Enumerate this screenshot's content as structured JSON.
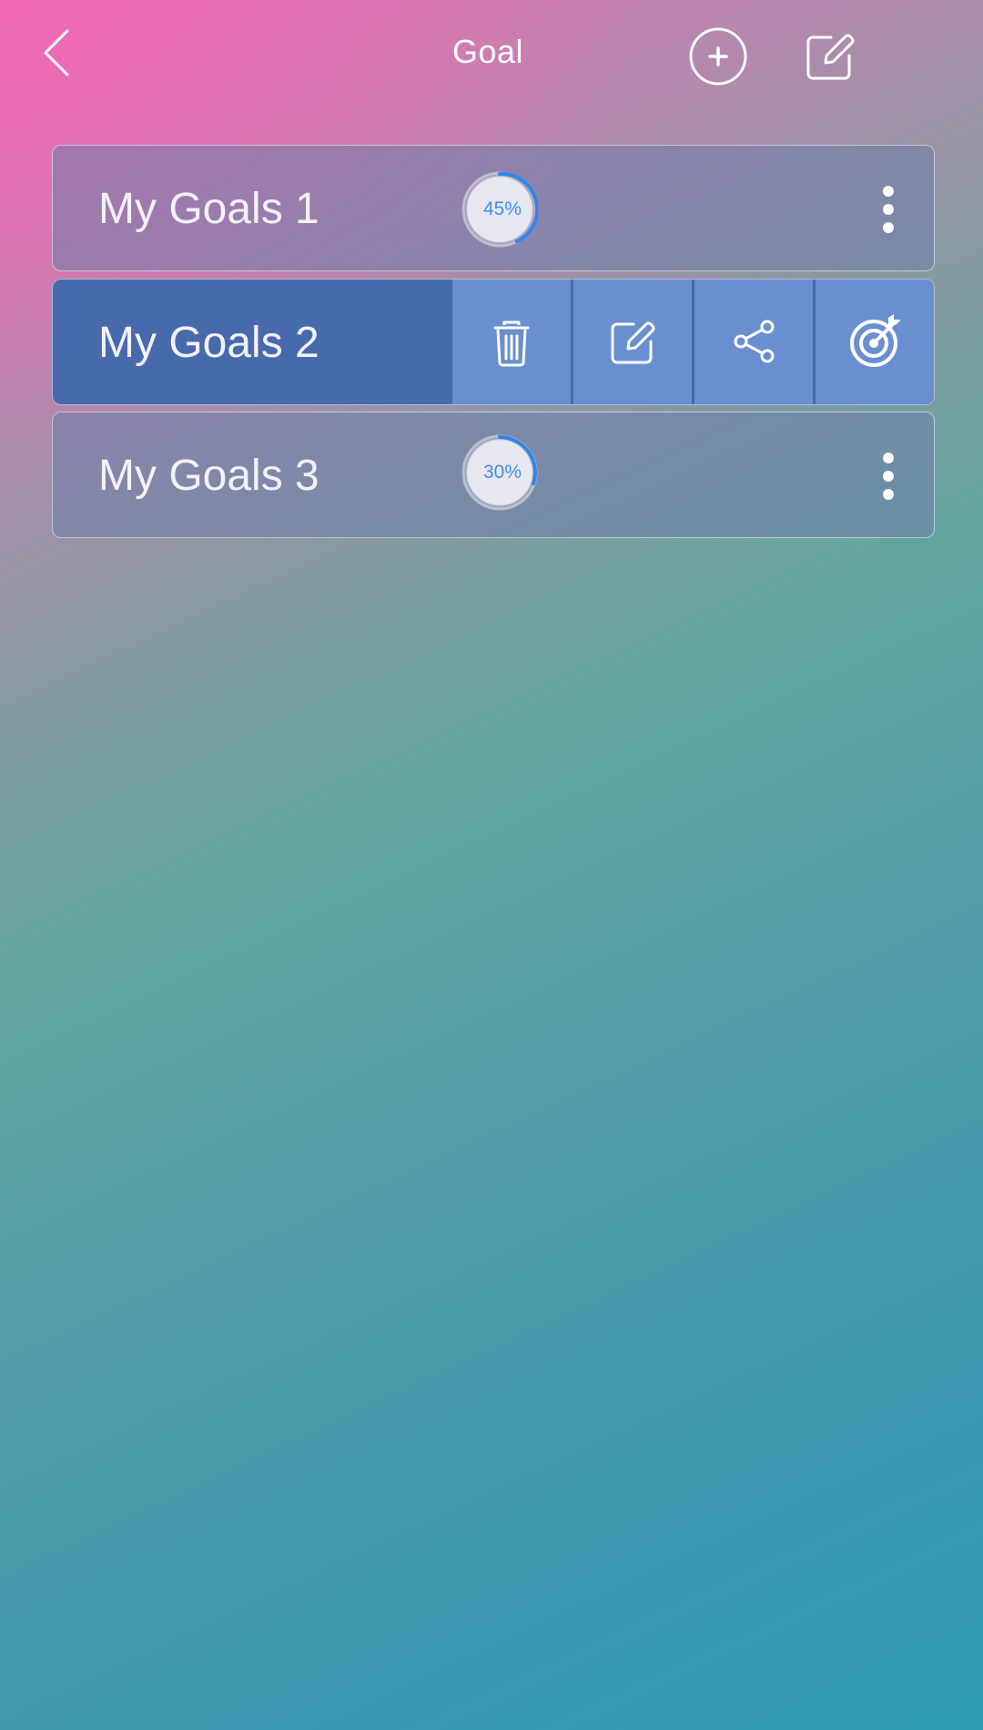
{
  "header": {
    "title": "Goal",
    "back_icon": "chevron-left-icon",
    "add_icon": "plus-circle-icon",
    "edit_icon": "edit-icon"
  },
  "goals": [
    {
      "name": "My Goals 1",
      "progress_label": "45%",
      "progress": 0.45,
      "state": "collapsed"
    },
    {
      "name": "My Goals 2",
      "state": "actions-revealed",
      "actions": [
        "trash-icon",
        "edit-icon",
        "share-icon",
        "target-icon"
      ]
    },
    {
      "name": "My Goals 3",
      "progress_label": "30%",
      "progress": 0.3,
      "state": "collapsed"
    }
  ],
  "colors": {
    "progress_ring": "#2f86ea",
    "row_selected": "#466aac",
    "action_bg": "#6a8fd0"
  }
}
